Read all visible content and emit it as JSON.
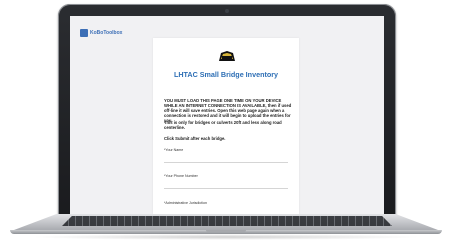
{
  "site": {
    "brand_text": "KoBoToolbox"
  },
  "form": {
    "logo_icon": "lhtac-shield-logo",
    "title": "LHTAC Small Bridge Inventory",
    "paragraphs": [
      "YOU MUST LOAD THIS PAGE ONE TIME ON YOUR DEVICE WHILE AN INTERNET CONNECTION IS AVAILABLE, then if used off-line it will save entries. Open this web page again when a connection is restored and it will begin to upload the entries for you.",
      "This is only for bridges or culverts 20ft and less along road centerline.",
      "Click Submit after each bridge."
    ],
    "fields": [
      {
        "label": "*Your Name"
      },
      {
        "label": "*Your Phone Number"
      },
      {
        "label": "*Administrative Jurisdiction"
      }
    ]
  },
  "colors": {
    "brand": "#3d6fb6",
    "title": "#2e6fb5",
    "bezel": "#1a1b1e"
  }
}
